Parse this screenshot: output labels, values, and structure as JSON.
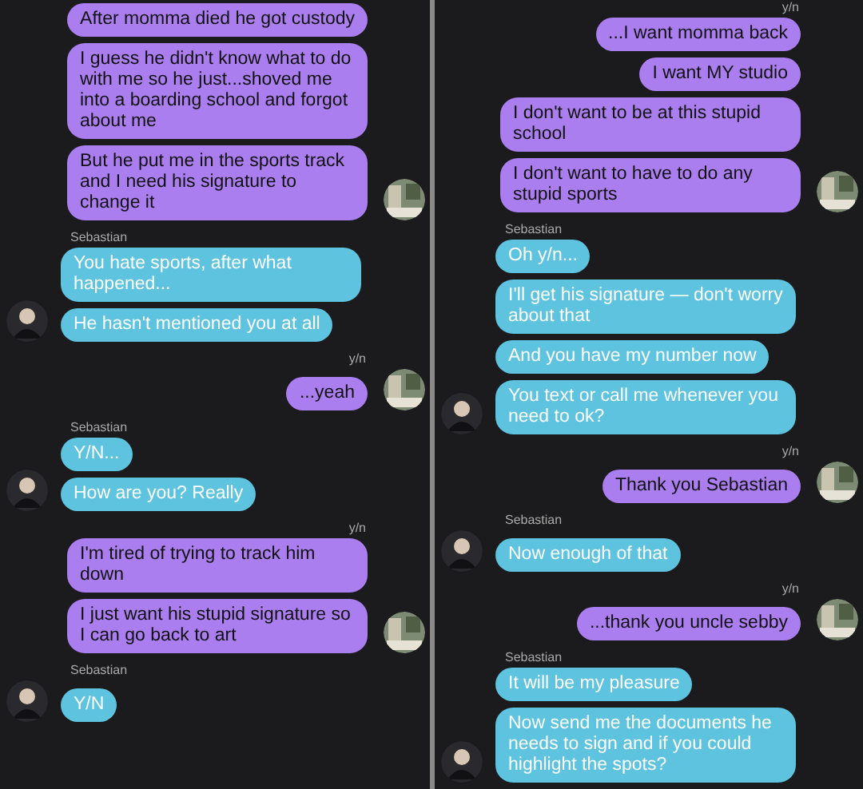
{
  "panels": [
    {
      "groups": [
        {
          "kind": "me",
          "messages": [
            "After momma died he got custody",
            "I guess he didn't know what to do with me so he just...shoved me into a boarding school and forgot about me",
            "But he put me in the sports track and I need his signature to change it"
          ]
        },
        {
          "kind": "them",
          "sender": "Sebastian",
          "messages": [
            "You hate sports, after what happened...",
            "He hasn't mentioned you at all"
          ]
        },
        {
          "kind": "me",
          "sender": "y/n",
          "messages": [
            "...yeah"
          ]
        },
        {
          "kind": "them",
          "sender": "Sebastian",
          "messages": [
            "Y/N...",
            "How are you? Really"
          ]
        },
        {
          "kind": "me",
          "sender": "y/n",
          "messages": [
            "I'm tired of trying to track him down",
            "I just want his stupid signature so I can go back to art"
          ]
        },
        {
          "kind": "them",
          "sender": "Sebastian",
          "messages": [
            "Y/N"
          ]
        }
      ]
    },
    {
      "groups": [
        {
          "kind": "me",
          "sender": "y/n",
          "messages": [
            "...I want momma back",
            "I want MY studio",
            "I don't want to be at this stupid school",
            "I don't want to have to do any stupid sports"
          ]
        },
        {
          "kind": "them",
          "sender": "Sebastian",
          "messages": [
            "Oh y/n...",
            "I'll get his signature — don't worry about that",
            "And you have my number now",
            "You text or call me whenever you need to ok?"
          ]
        },
        {
          "kind": "me",
          "sender": "y/n",
          "messages": [
            "Thank you Sebastian"
          ]
        },
        {
          "kind": "them",
          "sender": "Sebastian",
          "messages": [
            "Now enough of that"
          ]
        },
        {
          "kind": "me",
          "sender": "y/n",
          "messages": [
            "...thank you uncle sebby"
          ]
        },
        {
          "kind": "them",
          "sender": "Sebastian",
          "messages": [
            "It will be my pleasure",
            "Now send me the documents he needs to sign and if you could highlight the spots?"
          ]
        }
      ]
    }
  ]
}
